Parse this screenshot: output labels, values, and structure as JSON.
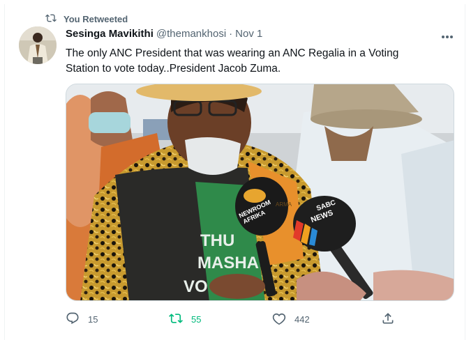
{
  "retweet_context": {
    "label": "You Retweeted",
    "icon": "retweet-icon"
  },
  "author": {
    "display_name": "Sesinga Mavikithi",
    "handle": "@themankhosi",
    "separator": "·",
    "date": "Nov 1"
  },
  "more_icon": "more-horizontal-icon",
  "text_line_1": "The only ANC President that was wearing an ANC Regalia in a Voting",
  "text_line_2": "Station to vote today..President Jacob Zuma.",
  "media": {
    "bib_text_1": "THU",
    "bib_text_2": "MASHA",
    "bib_text_3": "VO",
    "mic1_brand_1": "NEWROOM",
    "mic1_brand_2": "AFRIKA",
    "mic2_brand_1": "SABC",
    "mic2_brand_2": "NEWS",
    "bg_text": "ARMA"
  },
  "actions": {
    "reply_count": "15",
    "retweet_count": "55",
    "like_count": "442",
    "retweet_color": "#00ba7c",
    "muted_color": "#536471"
  }
}
